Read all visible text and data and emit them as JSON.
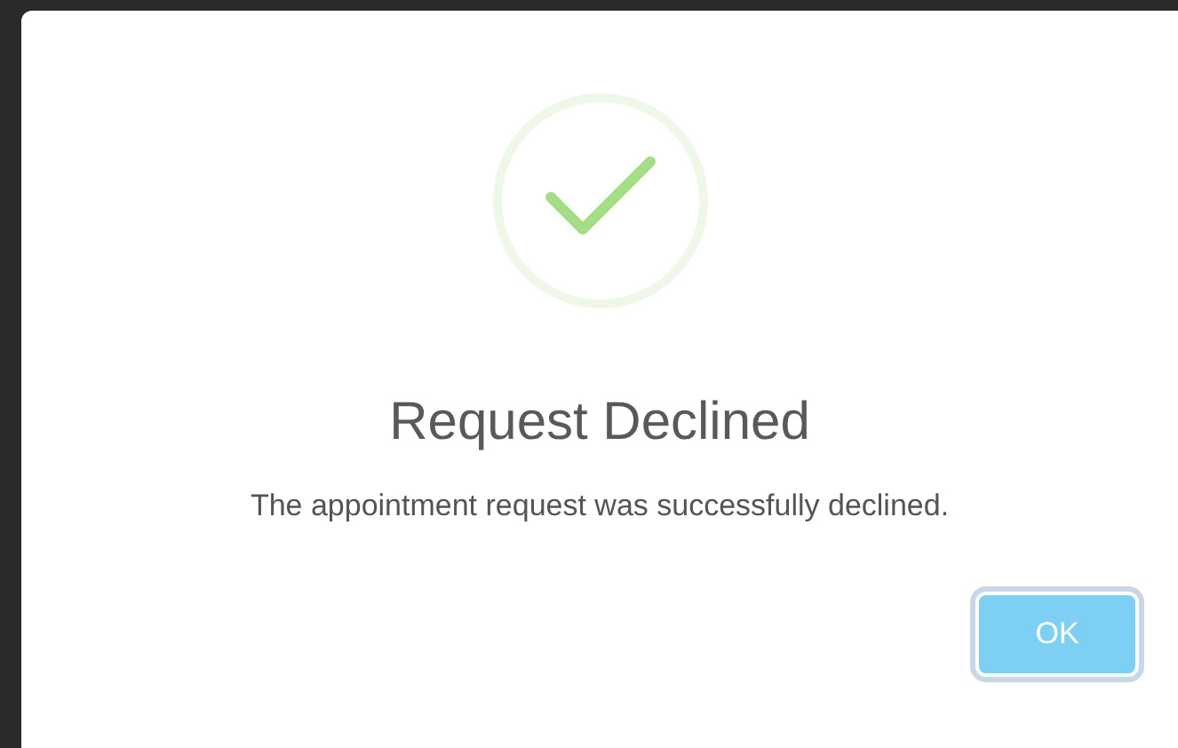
{
  "dialog": {
    "kind": "success",
    "title": "Request Declined",
    "message": "The appointment request was successfully declined.",
    "buttons": [
      {
        "label": "OK",
        "focused": true
      }
    ]
  }
}
